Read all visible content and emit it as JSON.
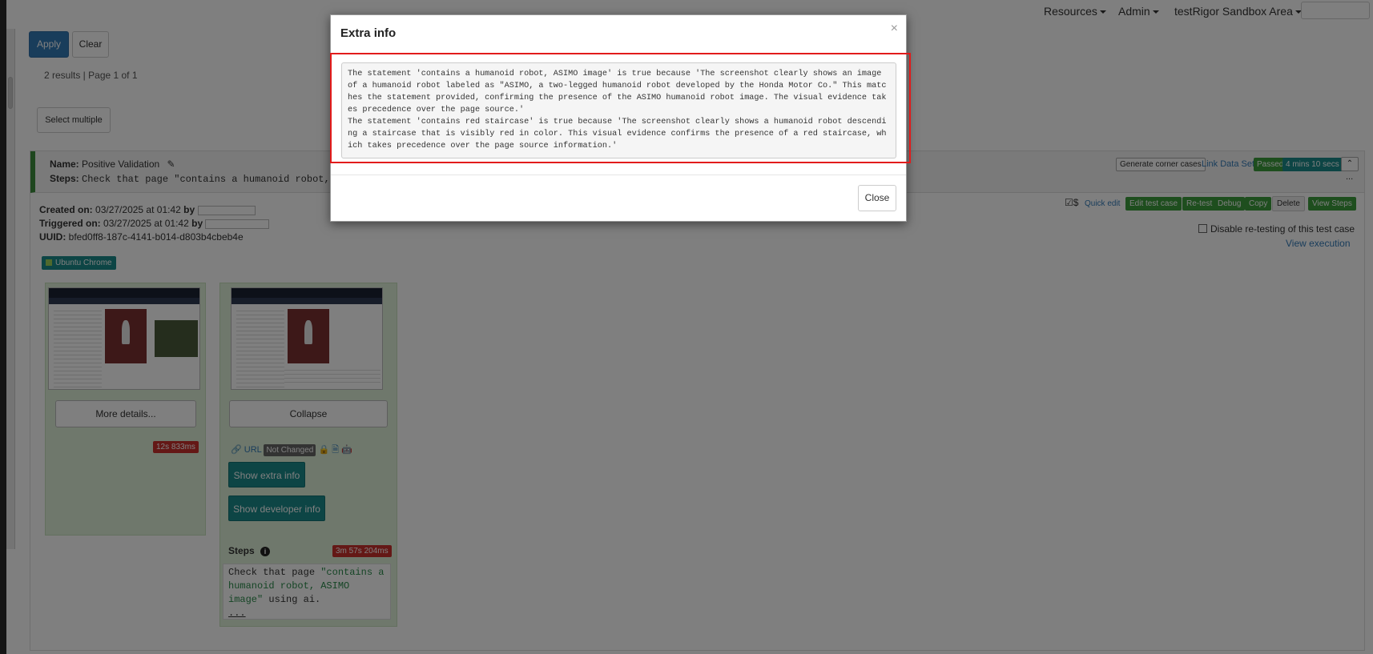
{
  "nav": {
    "resources": "Resources",
    "admin": "Admin",
    "sandbox": "testRigor Sandbox Area"
  },
  "filters": {
    "apply": "Apply",
    "clear": "Clear",
    "results": "2 results | Page 1 of 1",
    "select_multiple": "Select multiple"
  },
  "test": {
    "name_label": "Name:",
    "name_value": "Positive Validation",
    "steps_label": "Steps:",
    "steps_value": "Check that page \"contains a humanoid robot, AS",
    "generate_corner": "Generate corner cases",
    "link_data_set": "Link Data Set",
    "status": "Passed",
    "duration": "4 mins 10 secs",
    "more": "...",
    "created_label": "Created on:",
    "created_value": "03/27/2025 at 01:42",
    "triggered_label": "Triggered on:",
    "triggered_value": "03/27/2025 at 01:42",
    "by": "by",
    "uuid_label": "UUID:",
    "uuid_value": "bfed0ff8-187c-4141-b014-d803b4cbeb4e",
    "dollar": "$",
    "quick_edit": "Quick edit",
    "edit_test_case": "Edit test case",
    "retest": "Re-test",
    "debug": "Debug",
    "copy": "Copy",
    "delete": "Delete",
    "view_steps": "View Steps",
    "disable_retest": "Disable re-testing of this test case",
    "view_execution": "View execution",
    "os_badge": "Ubuntu Chrome"
  },
  "shots": {
    "more_details": "More details...",
    "collapse": "Collapse",
    "time1": "12s 833ms",
    "url": "URL",
    "not_changed": "Not Changed",
    "show_extra": "Show extra info",
    "show_dev": "Show developer info",
    "steps_title": "Steps",
    "steps_time": "3m 57s 204ms",
    "step_text_1": "Check that page ",
    "step_text_q": "\"contains a humanoid robot, ASIMO image\"",
    "step_text_2": " using ai.",
    "ellipsis": "..."
  },
  "modal": {
    "title": "Extra info",
    "close_x": "×",
    "body": "The statement 'contains a humanoid robot, ASIMO image' is true because 'The screenshot clearly shows an image of a humanoid robot labeled as \"ASIMO, a two-legged humanoid robot developed by the Honda Motor Co.\" This matches the statement provided, confirming the presence of the ASIMO humanoid robot image. The visual evidence takes precedence over the page source.'\nThe statement 'contains red staircase' is true because 'The screenshot clearly shows a humanoid robot descending a staircase that is visibly red in color. This visual evidence confirms the presence of a red staircase, which takes precedence over the page source information.'",
    "close": "Close"
  },
  "colors": {
    "accent": "#337ab7",
    "success": "#3c9c3c",
    "teal": "#1a8a8a",
    "danger": "#c9302c",
    "highlight": "#e21b1b"
  }
}
